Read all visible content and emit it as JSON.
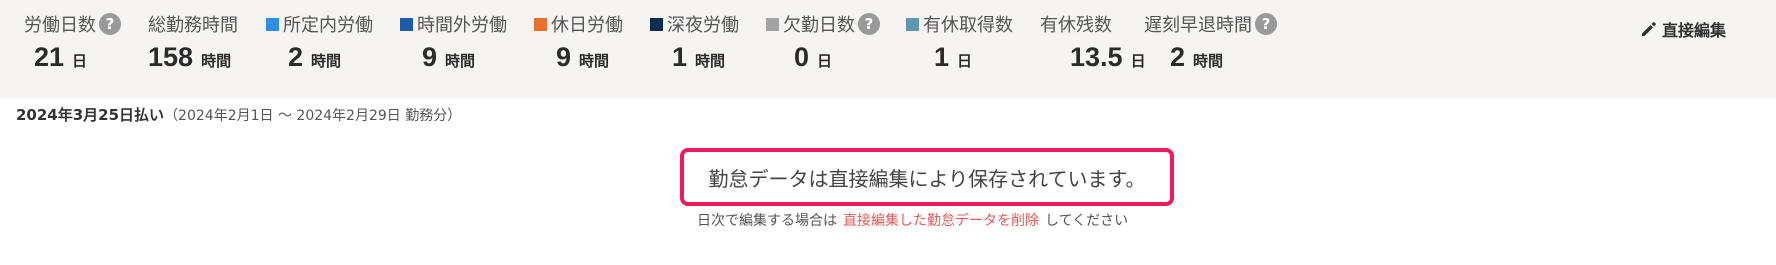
{
  "stats": [
    {
      "label": "労働日数",
      "value": "21",
      "unit": "日",
      "help": true
    },
    {
      "label": "総勤務時間",
      "value": "158",
      "unit": "時間"
    },
    {
      "label": "所定内労働",
      "value": "2",
      "unit": "時間",
      "color": "#2f8fe6"
    },
    {
      "label": "時間外労働",
      "value": "9",
      "unit": "時間",
      "color": "#1f5aa8"
    },
    {
      "label": "休日労働",
      "value": "9",
      "unit": "時間",
      "color": "#ec6f2d"
    },
    {
      "label": "深夜労働",
      "value": "1",
      "unit": "時間",
      "color": "#0f2d52"
    },
    {
      "label": "欠勤日数",
      "value": "0",
      "unit": "日",
      "color": "#a3a3a3",
      "help": true
    },
    {
      "label": "有休取得数",
      "value": "1",
      "unit": "日",
      "color": "#5f97b0"
    },
    {
      "label": "有休残数",
      "value": "13.5",
      "unit": "日"
    },
    {
      "label": "遅刻早退時間",
      "value": "2",
      "unit": "時間",
      "help": true
    }
  ],
  "help_glyph": "?",
  "edit_button": {
    "label": "直接編集",
    "icon": "pencil-icon"
  },
  "period": {
    "payday": "2024年3月25日払い",
    "range": "（2024年2月1日 〜 2024年2月29日 勤務分）"
  },
  "notice": {
    "message": "勤怠データは直接編集により保存されています。",
    "sub_prefix": "日次で編集する場合は",
    "link_text": "直接編集した勤怠データを削除",
    "sub_suffix": "してください",
    "border_color": "#f0195c"
  }
}
